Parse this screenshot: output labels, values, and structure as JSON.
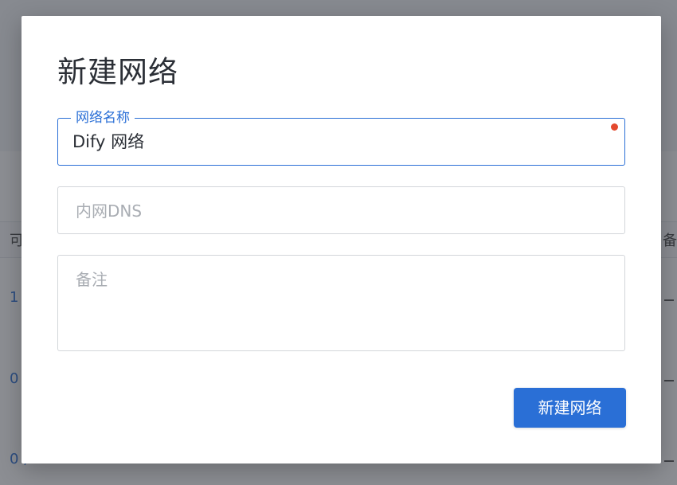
{
  "background": {
    "table": {
      "header_left": "可",
      "header_right": "备",
      "rows": [
        {
          "left": "1"
        },
        {
          "left": "0"
        },
        {
          "left": "0 ,"
        }
      ]
    }
  },
  "dialog": {
    "title": "新建网络",
    "fields": {
      "name": {
        "label": "网络名称",
        "value": "Dify 网络",
        "required": true
      },
      "dns": {
        "placeholder": "内网DNS"
      },
      "notes": {
        "placeholder": "备注"
      }
    },
    "submit_label": "新建网络"
  },
  "colors": {
    "accent": "#2a6fd6",
    "required": "#e4492e",
    "overlay": "#2d323a"
  }
}
